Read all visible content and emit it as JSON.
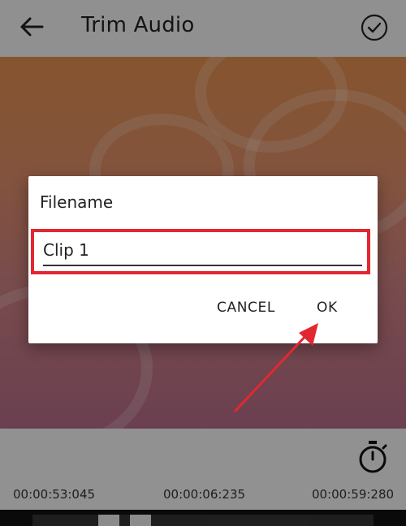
{
  "app": {
    "title": "Trim Audio",
    "back_icon": "arrow-left-icon",
    "done_icon": "check-circle-icon"
  },
  "controls": {
    "timer_icon": "stopwatch-icon",
    "start_time": "00:00:53:045",
    "duration": "00:00:06:235",
    "end_time": "00:00:59:280"
  },
  "dialog": {
    "title": "Filename",
    "input_value": "Clip 1",
    "cancel_label": "CANCEL",
    "ok_label": "OK"
  },
  "annotation": {
    "highlight_color": "#e32730",
    "arrow_color": "#e32730"
  }
}
